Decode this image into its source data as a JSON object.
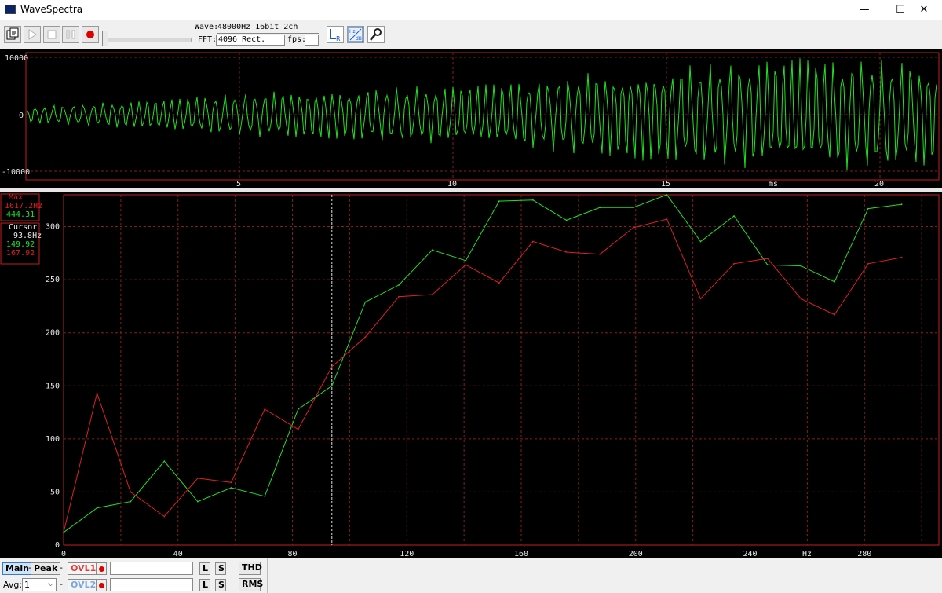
{
  "window": {
    "title": "WaveSpectra",
    "minimize_glyph": "—",
    "maximize_glyph": "☐",
    "close_glyph": "✕"
  },
  "toolbar": {
    "wave_label": "Wave:",
    "wave_value": "48000Hz 16bit 2ch",
    "fft_label": "FFT:",
    "fft_value": "4096 Rect.",
    "fps_label": "fps:",
    "fps_value": "",
    "icons": [
      "open-icon",
      "play-icon",
      "stop-icon",
      "pause-icon",
      "record-icon",
      "level-lr-icon",
      "hz-db-scale-icon",
      "settings-wrench-icon"
    ]
  },
  "waveform": {
    "y_ticks": [
      "10000",
      "0",
      "-10000"
    ],
    "x_ticks": [
      "5",
      "10",
      "15",
      "20"
    ],
    "x_unit": "ms",
    "trace_color": "#22e022",
    "frame_color": "#c02020"
  },
  "spectrum": {
    "legend": {
      "max_label": "Max",
      "max_freq": "1617.2Hz",
      "max_value": "444.31",
      "cursor_label": "Cursor",
      "cursor_freq": "93.8Hz",
      "cursor_value_green": "149.92",
      "cursor_value_red": "167.92"
    },
    "y_ticks": [
      "300",
      "250",
      "200",
      "150",
      "100",
      "50",
      "0"
    ],
    "x_ticks": [
      "0",
      "40",
      "80",
      "120",
      "160",
      "200",
      "240",
      "280"
    ],
    "x_unit": "Hz",
    "cursor_hz": 93.8
  },
  "chart_data": {
    "type": "line",
    "x": [
      0,
      11.7,
      23.4,
      35.2,
      46.9,
      58.6,
      70.3,
      82.0,
      93.8,
      105.5,
      117.2,
      128.9,
      140.6,
      152.3,
      164.1,
      175.8,
      187.5,
      199.2,
      210.9,
      222.7,
      234.4,
      246.1,
      257.8,
      269.5,
      281.3,
      293.0
    ],
    "series": [
      {
        "color": "#22e022",
        "values": [
          12,
          35,
          41,
          79,
          41,
          54,
          46,
          128,
          150,
          229,
          245,
          278,
          268,
          324,
          325,
          306,
          318,
          318,
          342,
          286,
          310,
          264,
          263,
          248,
          317,
          321
        ]
      },
      {
        "color": "#e02020",
        "values": [
          12,
          143,
          50,
          27,
          63,
          59,
          128,
          109,
          168,
          196,
          234,
          236,
          264,
          247,
          286,
          276,
          274,
          299,
          307,
          232,
          265,
          270,
          232,
          217,
          265,
          271
        ]
      }
    ],
    "xlim": [
      0,
      306
    ],
    "ylim": [
      0,
      330
    ],
    "xlabel": "Hz",
    "ylabel": "",
    "grid": true
  },
  "statusbar": {
    "main_label": "Main",
    "dash1": "-",
    "peak_label": "Peak",
    "ovl1_label": "OVL1",
    "ovl2_label": "OVL2",
    "l_label": "L",
    "s_label": "S",
    "thd_label": "THD",
    "rms_label": "RMS",
    "avg_label": "Avg:",
    "avg_value": "1",
    "dash2": "-"
  }
}
